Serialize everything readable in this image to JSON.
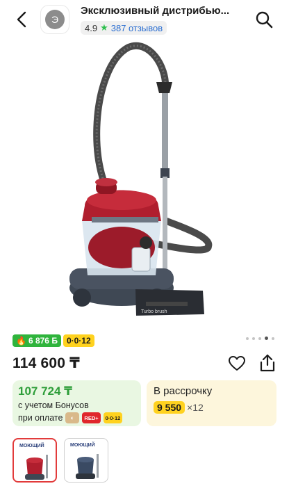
{
  "header": {
    "seller_name": "Эксклюзивный дистрибью...",
    "seller_initial": "Э",
    "rating": "4.9",
    "reviews": "387 отзывов"
  },
  "gallery": {
    "image_label": "Turbo brush",
    "dots_count": 5,
    "active_dot": 3
  },
  "promo": {
    "bonus": "6 876 Б",
    "plan": "0·0·12"
  },
  "price": {
    "value": "114 600 ₸"
  },
  "bonus_card": {
    "amount": "107 724 ₸",
    "line1": "с учетом Бонусов",
    "line2": "при оплате",
    "badge_red": "RED+",
    "badge_plan": "0·0·12"
  },
  "installment_card": {
    "title": "В рассрочку",
    "payment": "9 550",
    "months": "×12"
  },
  "thumbnails": [
    {
      "text": "МОЮЩИЙ"
    },
    {
      "text": "МОЮЩИЙ"
    }
  ],
  "colors": {
    "accent_green": "#2fb43c",
    "accent_yellow": "#ffd21f",
    "accent_red": "#e23b3b",
    "link_blue": "#2c6fd1"
  }
}
